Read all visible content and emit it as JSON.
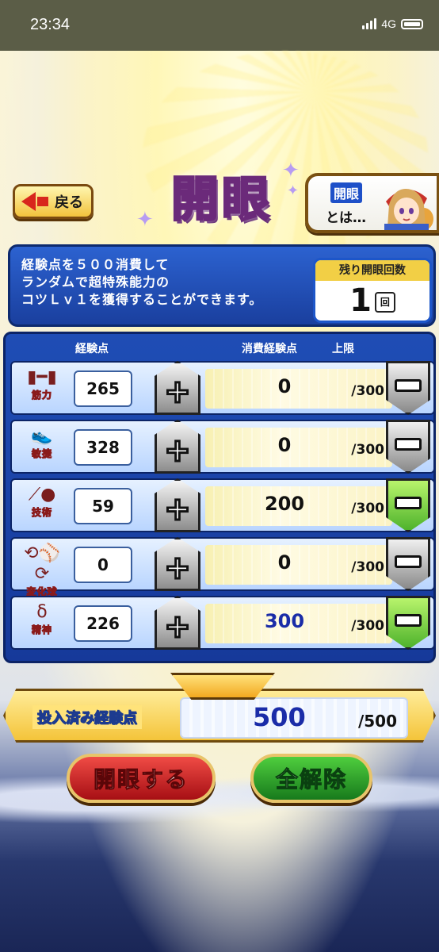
{
  "status": {
    "time": "23:34",
    "network": "4G"
  },
  "nav": {
    "back_label": "戻る"
  },
  "title": "開眼",
  "help": {
    "line1": "開眼",
    "line2": "とは…"
  },
  "info": {
    "description_lines": [
      "経験点を５００消費して",
      "ランダムで超特殊能力の",
      "コツＬｖ１を獲得することができます。"
    ],
    "remaining_title": "残り開眼回数",
    "remaining_value": "1",
    "remaining_unit": "回"
  },
  "table": {
    "headers": {
      "exp": "経験点",
      "consume": "消費経験点",
      "limit": "上限"
    },
    "rows": [
      {
        "label": "筋力",
        "icon": "dumbbell-icon",
        "exp": "265",
        "consume": "0",
        "cap": "/300",
        "minus_state": "gray"
      },
      {
        "label": "敏捷",
        "icon": "shoe-icon",
        "exp": "328",
        "consume": "0",
        "cap": "/300",
        "minus_state": "gray"
      },
      {
        "label": "技術",
        "icon": "bat-icon",
        "exp": "59",
        "consume": "200",
        "cap": "/300",
        "minus_state": "green"
      },
      {
        "label": "変化球",
        "icon": "ball-icon",
        "exp": "0",
        "consume": "0",
        "cap": "/300",
        "minus_state": "gray"
      },
      {
        "label": "精神",
        "icon": "spirit-icon",
        "exp": "226",
        "consume": "300",
        "cap": "/300",
        "minus_state": "green"
      }
    ]
  },
  "total": {
    "label": "投入済み経験点",
    "value": "500",
    "cap": "/500"
  },
  "actions": {
    "open_label": "開眼する",
    "clear_label": "全解除"
  }
}
